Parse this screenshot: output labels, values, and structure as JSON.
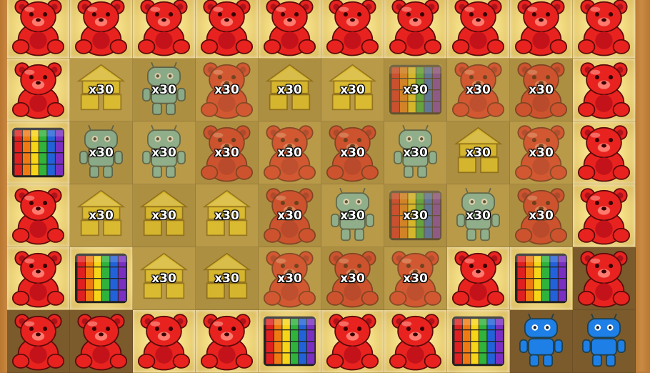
{
  "game": {
    "rows": 6,
    "cols": 10,
    "cells": [
      [
        "bear",
        "bear",
        "bear",
        "bear",
        "bear",
        "bear",
        "bear",
        "bear",
        "bear",
        "bear"
      ],
      [
        "bear",
        "house",
        "robot",
        "bear",
        "house",
        "house",
        "cube",
        "bear",
        "bear",
        "bear"
      ],
      [
        "cube",
        "robot",
        "robot",
        "bear",
        "bear",
        "bear",
        "robot",
        "house",
        "bear",
        "bear"
      ],
      [
        "bear",
        "house",
        "house",
        "house",
        "bear",
        "robot",
        "cube",
        "robot",
        "bear",
        "bear"
      ],
      [
        "bear",
        "cube",
        "house",
        "house",
        "bear",
        "bear",
        "bear",
        "bear",
        "cube",
        "bear"
      ],
      [
        "bear",
        "bear",
        "bear",
        "bear",
        "cube",
        "bear",
        "bear",
        "cube",
        "robot",
        "robot"
      ]
    ],
    "locks": [
      [
        false,
        false,
        false,
        false,
        false,
        false,
        false,
        false,
        false,
        false
      ],
      [
        false,
        true,
        true,
        true,
        true,
        true,
        true,
        true,
        true,
        false
      ],
      [
        false,
        true,
        true,
        true,
        true,
        true,
        true,
        true,
        true,
        false
      ],
      [
        false,
        true,
        true,
        true,
        true,
        true,
        true,
        true,
        true,
        false
      ],
      [
        false,
        false,
        true,
        true,
        true,
        true,
        true,
        false,
        false,
        false
      ],
      [
        false,
        false,
        false,
        false,
        false,
        false,
        false,
        false,
        false,
        false
      ]
    ],
    "lit": [
      [
        true,
        true,
        true,
        true,
        true,
        true,
        true,
        true,
        true,
        true
      ],
      [
        true,
        false,
        false,
        false,
        false,
        false,
        false,
        false,
        false,
        true
      ],
      [
        true,
        false,
        false,
        false,
        false,
        false,
        false,
        false,
        false,
        true
      ],
      [
        true,
        false,
        false,
        false,
        false,
        false,
        false,
        false,
        false,
        true
      ],
      [
        true,
        true,
        false,
        false,
        false,
        false,
        false,
        true,
        true,
        false
      ],
      [
        false,
        false,
        true,
        true,
        true,
        true,
        true,
        true,
        false,
        false
      ]
    ],
    "lock_label": "x30",
    "colors": {
      "bear": "#e8231f",
      "house": "#f5d21a",
      "robot": "#6fbfbf",
      "robot_active": "#1e7fe6"
    }
  }
}
